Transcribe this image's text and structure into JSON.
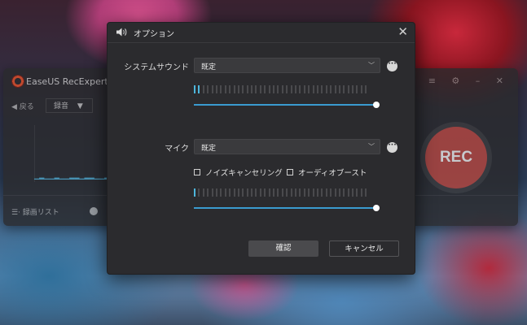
{
  "background_app": {
    "title": "EaseUS RecExperts",
    "back_label": "◀ 戻る",
    "mode_label": "録音",
    "mode_chevron": "▼",
    "list_label": "録画リスト",
    "rec_label": "REC",
    "rec_color": "#b3463f"
  },
  "dialog": {
    "title": "オプション",
    "title_icon": "speaker-icon",
    "close_glyph": "✕",
    "system_sound": {
      "label": "システムサウンド",
      "value": "既定",
      "level_active_bars": 2,
      "volume": 1.0
    },
    "mic": {
      "label": "マイク",
      "value": "既定",
      "level_active_bars": 1,
      "volume": 1.0
    },
    "checkbox_noise": {
      "label": "ノイズキャンセリング",
      "checked": false
    },
    "checkbox_boost": {
      "label": "オーディオブースト",
      "checked": false
    },
    "ok_label": "確認",
    "cancel_label": "キャンセル",
    "accent_color": "#3a9bd0"
  }
}
